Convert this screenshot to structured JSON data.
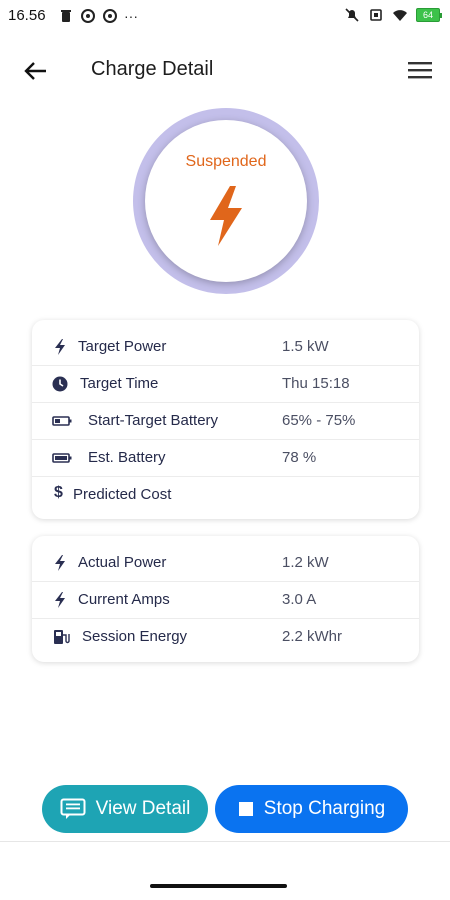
{
  "status_bar": {
    "time": "16.56",
    "dots": "···",
    "battery_level": "64"
  },
  "header": {
    "title": "Charge Detail"
  },
  "charge_status": {
    "label": "Suspended",
    "accent": "#e0661b",
    "ring_color": "#c3bfea"
  },
  "target_card": {
    "rows": [
      {
        "icon": "bolt-icon",
        "label": "Target Power",
        "value": "1.5 kW"
      },
      {
        "icon": "clock-icon",
        "label": "Target Time",
        "value": "Thu 15:18"
      },
      {
        "icon": "battery-low-icon",
        "label": "Start-Target Battery",
        "value": "65% - 75%"
      },
      {
        "icon": "battery-full-icon",
        "label": "Est. Battery",
        "value": "78 %"
      },
      {
        "icon": "dollar-icon",
        "label": "Predicted Cost",
        "value": ""
      }
    ]
  },
  "actual_card": {
    "rows": [
      {
        "icon": "bolt-icon",
        "label": "Actual Power",
        "value": "1.2 kW"
      },
      {
        "icon": "bolt-icon",
        "label": "Current Amps",
        "value": "3.0 A"
      },
      {
        "icon": "ev-station-icon",
        "label": "Session Energy",
        "value": "2.2 kWhr"
      }
    ]
  },
  "actions": {
    "view_detail": "View Detail",
    "stop_charging": "Stop Charging",
    "view_color": "#1ea4b4",
    "stop_color": "#0a73f0"
  }
}
